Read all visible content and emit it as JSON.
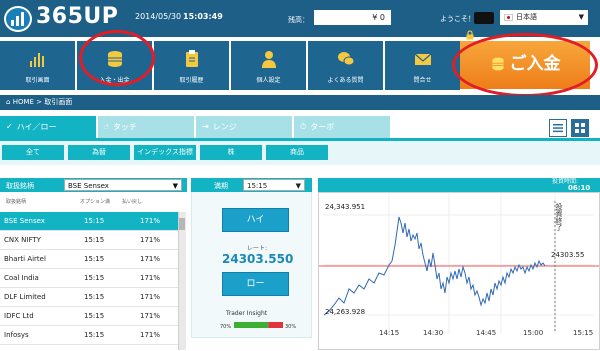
{
  "header": {
    "logo_text": "365UP",
    "date": "2014/05/30",
    "time": "15:03:49",
    "balance_label": "残高：",
    "balance_value": "¥ 0",
    "welcome_text": "ようこそ！",
    "language": "日本語",
    "language_arrow": "▼"
  },
  "nav": {
    "items": [
      {
        "label": "取引画面",
        "icon": "bar-chart-icon"
      },
      {
        "label": "入金・出金",
        "icon": "coins-icon"
      },
      {
        "label": "取引履歴",
        "icon": "clipboard-icon"
      },
      {
        "label": "個人設定",
        "icon": "person-icon"
      },
      {
        "label": "よくある質問",
        "icon": "chat-bubbles-icon"
      },
      {
        "label": "問合せ",
        "icon": "envelope-icon"
      }
    ],
    "deposit_label": "ご入金"
  },
  "breadcrumb": {
    "home": "HOME",
    "separator": ">",
    "current": "取引画面"
  },
  "tabs": [
    {
      "label": "ハイ／ロー",
      "active": true
    },
    {
      "label": "タッチ",
      "active": false
    },
    {
      "label": "レンジ",
      "active": false
    },
    {
      "label": "ターボ",
      "active": false
    }
  ],
  "categories": [
    "全て",
    "為替",
    "インデックス指標",
    "株",
    "商品"
  ],
  "left_panel": {
    "header_label": "取扱銘柄",
    "selected_asset": "BSE Sensex",
    "select_arrow": "▼",
    "col_asset": "取扱銘柄",
    "col_option_expiry": "オプション満",
    "col_payout": "払い戻し",
    "rows": [
      {
        "name": "BSE Sensex",
        "time": "15:15",
        "payout": "171%",
        "selected": true
      },
      {
        "name": "CNX NIFTY",
        "time": "15:15",
        "payout": "171%",
        "selected": false
      },
      {
        "name": "Bharti Airtel",
        "time": "15:15",
        "payout": "171%",
        "selected": false
      },
      {
        "name": "Coal India",
        "time": "15:15",
        "payout": "171%",
        "selected": false
      },
      {
        "name": "DLF Limited",
        "time": "15:15",
        "payout": "171%",
        "selected": false
      },
      {
        "name": "IDFC Ltd",
        "time": "15:15",
        "payout": "171%",
        "selected": false
      },
      {
        "name": "Infosys",
        "time": "15:15",
        "payout": "171%",
        "selected": false
      }
    ]
  },
  "middle_panel": {
    "expiry_label": "満期",
    "expiry_value": "15:15",
    "select_arrow": "▼",
    "high_label": "ハイ",
    "rate_label": "レート:",
    "rate_value": "24303.550",
    "low_label": "ロー",
    "trader_insight_label": "Trader Insight",
    "insight_left": "70%",
    "insight_right": "30%",
    "insight_left_fraction": 0.7,
    "colors": {
      "up": "#3cb034",
      "down": "#e0333a"
    }
  },
  "chart": {
    "time_label": "投資時間:",
    "time_value": "06:10",
    "y_top": "24,343.951",
    "y_bottom": "24,263.928",
    "current_label": "24303.55",
    "vertical_label": "投資終了",
    "x_labels": [
      "14:15",
      "14:30",
      "14:45",
      "15:00",
      "15:15"
    ],
    "line_color": "#2f69b5",
    "current_line_color": "#f05a5a"
  }
}
